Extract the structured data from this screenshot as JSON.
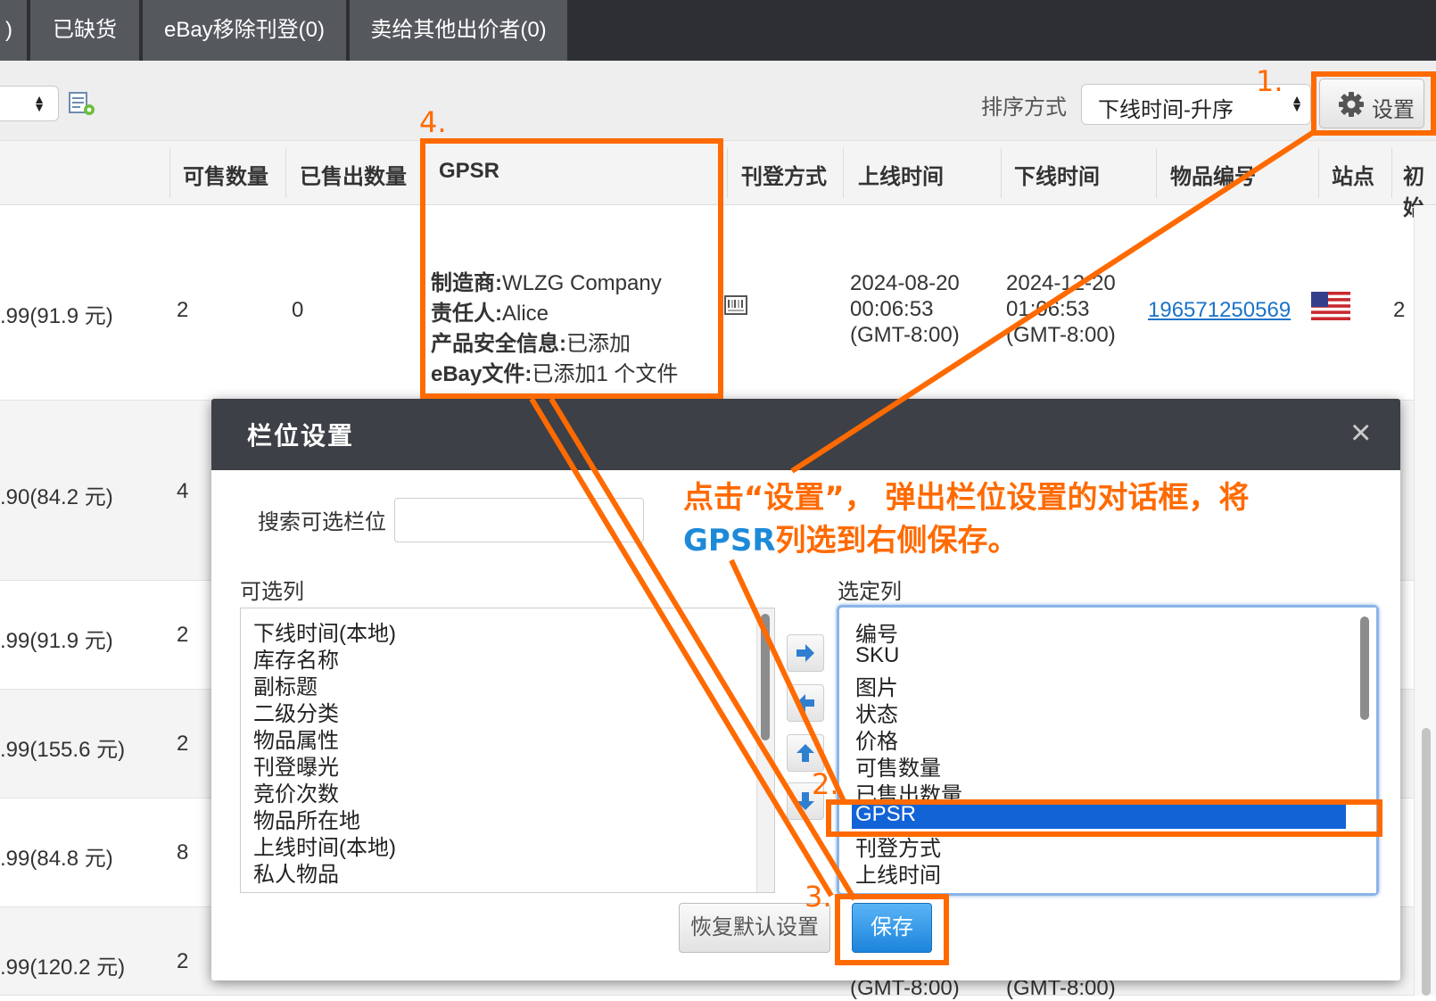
{
  "tabs": [
    {
      "label": ")"
    },
    {
      "label": "已缺货"
    },
    {
      "label": "eBay移除刊登(0)"
    },
    {
      "label": "卖给其他出价者(0)"
    }
  ],
  "toolbar": {
    "sort_label": "排序方式",
    "sort_value": "下线时间-升序",
    "settings_label": "设置"
  },
  "table": {
    "headers": [
      "可售数量",
      "已售出数量",
      "GPSR",
      "刊登方式",
      "上线时间",
      "下线时间",
      "物品编号",
      "站点",
      "初始"
    ],
    "row1": {
      "price": ".99(91.9 元)",
      "qty": "2",
      "sold": "0",
      "gpsr": {
        "manufacturer_label": "制造商:",
        "manufacturer": "WLZG Company",
        "responsible_label": "责任人:",
        "responsible": "Alice",
        "safety_label": "产品安全信息:",
        "safety": "已添加",
        "docs_label": "eBay文件:",
        "docs": "已添加1 个文件"
      },
      "online_date": "2024-08-20",
      "online_time": "00:06:53",
      "online_tz": "(GMT-8:00)",
      "offline_date": "2024-12-20",
      "offline_time": "01:06:53",
      "offline_tz": "(GMT-8:00)",
      "item_id": "196571250569",
      "initial": "2"
    },
    "rows": [
      {
        "price": ".90(84.2 元)",
        "qty": "4"
      },
      {
        "price": ".99(91.9 元)",
        "qty": "2"
      },
      {
        "price": ".99(155.6 元)",
        "qty": "2"
      },
      {
        "price": ".99(84.8 元)",
        "qty": "8"
      },
      {
        "price": ".99(120.2 元)",
        "qty": "2"
      }
    ],
    "bottom_tz_1": "(GMT-8:00)",
    "bottom_tz_2": "(GMT-8:00)"
  },
  "dialog": {
    "title": "栏位设置",
    "close": "×",
    "search_label": "搜索可选栏位",
    "search_value": "",
    "available_title": "可选列",
    "available": [
      "下线时间(本地)",
      "库存名称",
      "副标题",
      "二级分类",
      "物品属性",
      "刊登曝光",
      "竞价次数",
      "物品所在地",
      "上线时间(本地)",
      "私人物品"
    ],
    "selected_title": "选定列",
    "selected": [
      "编号",
      "SKU",
      "图片",
      "状态",
      "价格",
      "可售数量",
      "已售出数量",
      "GPSR",
      "刊登方式",
      "上线时间"
    ],
    "selected_index": 7,
    "reset_label": "恢复默认设置",
    "save_label": "保存"
  },
  "annotations": {
    "step1": "1.",
    "step2": "2.",
    "step3": "3.",
    "step4": "4.",
    "note_part1": "点击“设置”， 弹出栏位设置的对话框，将",
    "note_blue": "GPSR",
    "note_part2": "列选到右侧保存。",
    "color": "#ff6a00"
  },
  "colors": {
    "tab_bg": "#55585d",
    "tabbar_bg": "#2d2f33",
    "link": "#1a73c9",
    "selection": "#1263d6",
    "save_btn": "#2a8ee0"
  }
}
